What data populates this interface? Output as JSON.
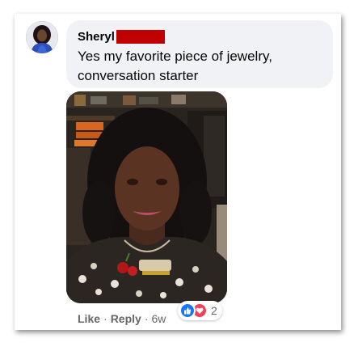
{
  "comment": {
    "author": "Sheryl",
    "text": "Yes my favorite piece of jewelry, conversation starter",
    "actions": {
      "like_label": "Like",
      "separator": "·",
      "reply_label": "Reply",
      "timestamp": "6w"
    },
    "reactions": {
      "icons": [
        "like-icon",
        "love-icon"
      ],
      "count": "2"
    }
  },
  "colors": {
    "bubble": "#f0f2f5",
    "redaction": "#c00000",
    "like": "#1877f2",
    "love": "#f33e58",
    "meta_text": "#65676b"
  }
}
